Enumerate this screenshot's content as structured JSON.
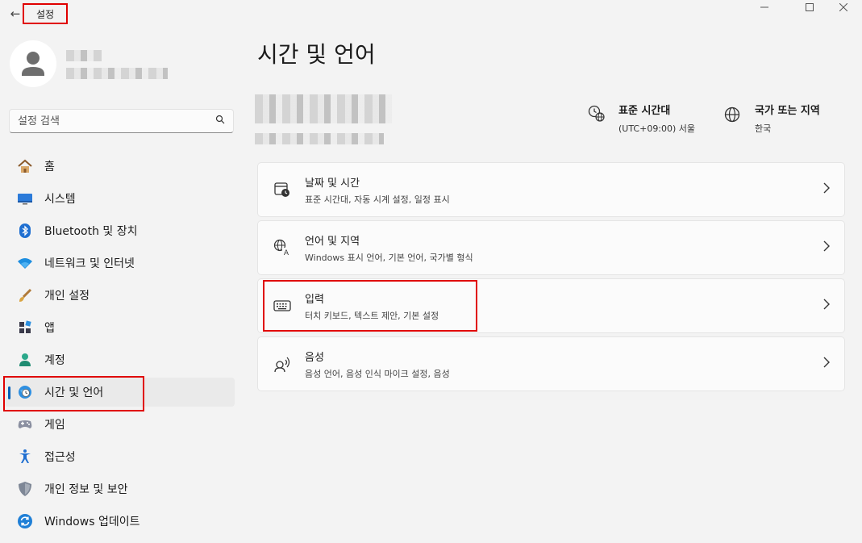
{
  "window": {
    "title": "설정"
  },
  "profile": {},
  "search": {
    "placeholder": "설정 검색"
  },
  "nav": [
    {
      "label": "홈",
      "icon": "home-icon",
      "selected": false
    },
    {
      "label": "시스템",
      "icon": "monitor-icon",
      "selected": false
    },
    {
      "label": "Bluetooth 및 장치",
      "icon": "bluetooth-icon",
      "selected": false
    },
    {
      "label": "네트워크 및 인터넷",
      "icon": "wifi-icon",
      "selected": false
    },
    {
      "label": "개인 설정",
      "icon": "brush-icon",
      "selected": false
    },
    {
      "label": "앱",
      "icon": "apps-icon",
      "selected": false
    },
    {
      "label": "계정",
      "icon": "account-icon",
      "selected": false
    },
    {
      "label": "시간 및 언어",
      "icon": "globe-clock-icon",
      "selected": true
    },
    {
      "label": "게임",
      "icon": "gamepad-icon",
      "selected": false
    },
    {
      "label": "접근성",
      "icon": "accessibility-icon",
      "selected": false
    },
    {
      "label": "개인 정보 및 보안",
      "icon": "shield-icon",
      "selected": false
    },
    {
      "label": "Windows 업데이트",
      "icon": "update-icon",
      "selected": false
    }
  ],
  "main": {
    "title": "시간 및 언어",
    "timezone": {
      "title": "표준 시간대",
      "value": "(UTC+09:00) 서울"
    },
    "region": {
      "title": "국가 또는 지역",
      "value": "한국"
    },
    "cards": [
      {
        "title": "날짜 및 시간",
        "subtitle": "표준 시간대, 자동 시계 설정, 일정 표시",
        "icon": "calendar-clock-icon"
      },
      {
        "title": "언어 및 지역",
        "subtitle": "Windows 표시 언어, 기본 언어, 국가별 형식",
        "icon": "language-icon"
      },
      {
        "title": "입력",
        "subtitle": "터치 키보드, 텍스트 제안, 기본 설정",
        "icon": "keyboard-icon"
      },
      {
        "title": "음성",
        "subtitle": "음성 언어, 음성 인식 마이크 설정, 음성",
        "icon": "speech-icon"
      }
    ]
  },
  "colors": {
    "accent": "#005fb8",
    "highlight": "#e00000",
    "background": "#f3f3f3",
    "card": "#fbfbfb"
  }
}
